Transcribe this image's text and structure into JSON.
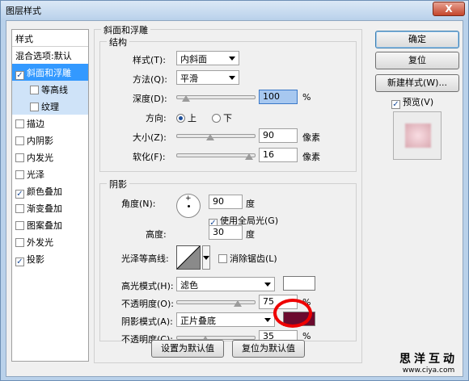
{
  "window": {
    "title": "图层样式",
    "close": "X"
  },
  "left_list": {
    "header": "样式",
    "items": [
      {
        "label": "混合选项:默认",
        "checkbox": false,
        "checked": false
      },
      {
        "label": "斜面和浮雕",
        "checkbox": true,
        "checked": true,
        "selected": true
      },
      {
        "label": "等高线",
        "checkbox": true,
        "checked": false,
        "sub": true
      },
      {
        "label": "纹理",
        "checkbox": true,
        "checked": false,
        "sub": true
      },
      {
        "label": "描边",
        "checkbox": true,
        "checked": false
      },
      {
        "label": "内阴影",
        "checkbox": true,
        "checked": false
      },
      {
        "label": "内发光",
        "checkbox": true,
        "checked": false
      },
      {
        "label": "光泽",
        "checkbox": true,
        "checked": false
      },
      {
        "label": "颜色叠加",
        "checkbox": true,
        "checked": true
      },
      {
        "label": "渐变叠加",
        "checkbox": true,
        "checked": false
      },
      {
        "label": "图案叠加",
        "checkbox": true,
        "checked": false
      },
      {
        "label": "外发光",
        "checkbox": true,
        "checked": false
      },
      {
        "label": "投影",
        "checkbox": true,
        "checked": true
      }
    ]
  },
  "bevel": {
    "group_title": "斜面和浮雕",
    "structure": {
      "title": "结构",
      "style_label": "样式(T):",
      "style_value": "内斜面",
      "method_label": "方法(Q):",
      "method_value": "平滑",
      "depth_label": "深度(D):",
      "depth_value": "100",
      "depth_unit": "%",
      "direction_label": "方向:",
      "dir_up": "上",
      "dir_down": "下",
      "size_label": "大小(Z):",
      "size_value": "90",
      "size_unit": "像素",
      "soften_label": "软化(F):",
      "soften_value": "16",
      "soften_unit": "像素"
    },
    "shading": {
      "title": "阴影",
      "angle_label": "角度(N):",
      "angle_value": "90",
      "angle_unit": "度",
      "global_light": "使用全局光(G)",
      "altitude_label": "高度:",
      "altitude_value": "30",
      "altitude_unit": "度",
      "gloss_label": "光泽等高线:",
      "antialias": "消除锯齿(L)",
      "highlight_label": "高光模式(H):",
      "highlight_value": "滤色",
      "opacity1_label": "不透明度(O):",
      "opacity1_value": "75",
      "opacity_unit": "%",
      "shadow_label": "阴影模式(A):",
      "shadow_value": "正片叠底",
      "opacity2_label": "不透明度(C):",
      "opacity2_value": "35"
    },
    "make_default": "设置为默认值",
    "reset_default": "复位为默认值"
  },
  "colors": {
    "highlight": "#ffffff",
    "shadow": "#6b0a2e",
    "selection": "#3399ff"
  },
  "right_buttons": {
    "ok": "确定",
    "reset": "复位",
    "new_style": "新建样式(W)...",
    "preview": "预览(V)"
  },
  "watermark": {
    "line1": "思洋互动",
    "line2": "www.ciya.com"
  }
}
